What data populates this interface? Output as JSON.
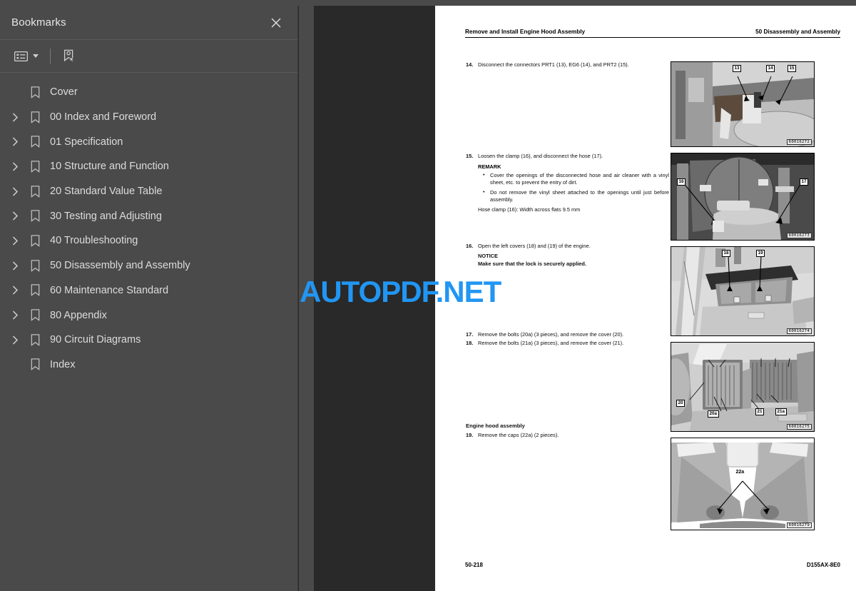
{
  "sidebar": {
    "title": "Bookmarks",
    "close_icon": "close-icon",
    "toolbar": {
      "options_icon": "list-options-icon",
      "new_bookmark_icon": "new-bookmark-icon"
    },
    "items": [
      {
        "label": "Cover",
        "expandable": false
      },
      {
        "label": "00 Index and Foreword",
        "expandable": true
      },
      {
        "label": "01 Specification",
        "expandable": true
      },
      {
        "label": "10 Structure and Function",
        "expandable": true
      },
      {
        "label": "20 Standard Value Table",
        "expandable": true
      },
      {
        "label": "30 Testing and Adjusting",
        "expandable": true
      },
      {
        "label": "40 Troubleshooting",
        "expandable": true
      },
      {
        "label": "50 Disassembly and Assembly",
        "expandable": true
      },
      {
        "label": "60 Maintenance Standard",
        "expandable": true
      },
      {
        "label": "80 Appendix",
        "expandable": true
      },
      {
        "label": "90 Circuit Diagrams",
        "expandable": true
      },
      {
        "label": "Index",
        "expandable": false
      }
    ]
  },
  "watermark": {
    "text_primary": "AUTOPDF",
    "text_secondary": ".NET",
    "color": "#2196f3"
  },
  "page": {
    "header_left": "Remove and Install Engine Hood Assembly",
    "header_right": "50 Disassembly and Assembly",
    "footer_left": "50-218",
    "footer_right": "D155AX-8E0",
    "steps": [
      {
        "num": "14.",
        "text": "Disconnect the connectors PRT1 (13), EG6 (14), and PRT2 (15)."
      },
      {
        "num": "15.",
        "text": "Loosen the clamp (16), and disconnect the hose (17).",
        "remark_head": "REMARK",
        "bullets": [
          "Cover the openings of the disconnected hose and air cleaner with a vinyl sheet, etc. to prevent the entry of dirt.",
          "Do not remove the vinyl sheet attached to the openings until just before assembly."
        ],
        "note": "Hose clamp (16): Width across flats 9.5 mm"
      },
      {
        "num": "16.",
        "text": "Open the left covers (18) and (19) of the engine.",
        "notice_head": "NOTICE",
        "notice_text": "Make sure that the lock is securely applied."
      },
      {
        "num": "17.",
        "text": "Remove the bolts (20a) (3 pieces), and remove the cover (20)."
      },
      {
        "num": "18.",
        "text": "Remove the bolts (21a) (3 pieces), and remove the cover (21)."
      }
    ],
    "section_title": "Engine hood assembly",
    "step19": {
      "num": "19.",
      "text": "Remove the caps (22a) (2 pieces)."
    },
    "figures": [
      {
        "id": "60016272",
        "callouts": [
          "13",
          "14",
          "15"
        ]
      },
      {
        "id": "60016273",
        "callouts": [
          "16",
          "17"
        ]
      },
      {
        "id": "60016274",
        "callouts": [
          "18",
          "19"
        ]
      },
      {
        "id": "60016275",
        "callouts": [
          "20",
          "20a",
          "21",
          "21a"
        ]
      },
      {
        "id": "60016279",
        "callouts": [
          "22a"
        ]
      }
    ]
  }
}
